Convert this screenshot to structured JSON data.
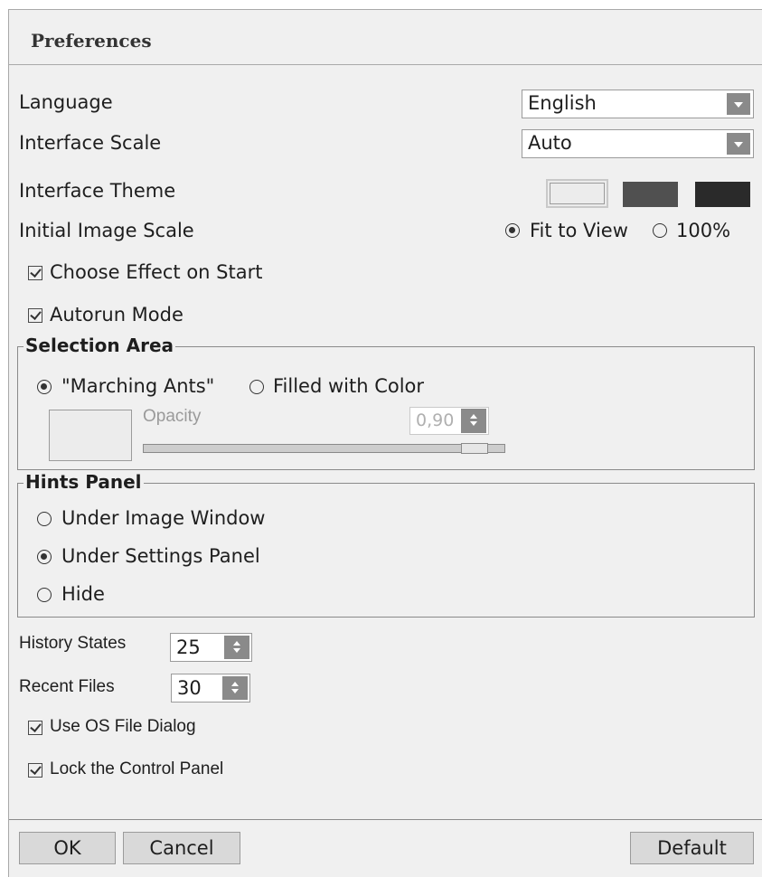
{
  "dialog": {
    "title": "Preferences",
    "language": {
      "label": "Language",
      "value": "English"
    },
    "interface_scale": {
      "label": "Interface Scale",
      "value": "Auto"
    },
    "interface_theme": {
      "label": "Interface Theme",
      "selected": "light",
      "colors": [
        "#ececec",
        "#505050",
        "#2a2a2a"
      ]
    },
    "initial_image_scale": {
      "label": "Initial Image Scale",
      "options": [
        "Fit to View",
        "100%"
      ],
      "selected": "Fit to View"
    },
    "choose_effect_on_start": {
      "label": "Choose Effect on Start",
      "checked": true
    },
    "autorun_mode": {
      "label": "Autorun Mode",
      "checked": true
    },
    "selection_area": {
      "title": "Selection Area",
      "options": [
        "\"Marching Ants\"",
        "Filled with Color"
      ],
      "selected": "\"Marching Ants\"",
      "opacity_label": "Opacity",
      "opacity_value": "0,90",
      "opacity_fraction": 0.9
    },
    "hints_panel": {
      "title": "Hints Panel",
      "options": [
        "Under Image Window",
        "Under Settings Panel",
        "Hide"
      ],
      "selected": "Under Settings Panel"
    },
    "history_states": {
      "label": "History States",
      "value": "25"
    },
    "recent_files": {
      "label": "Recent Files",
      "value": "30"
    },
    "use_os_file_dialog": {
      "label": "Use OS File Dialog",
      "checked": true
    },
    "lock_control_panel": {
      "label": "Lock the Control Panel",
      "checked": true
    },
    "buttons": {
      "ok": "OK",
      "cancel": "Cancel",
      "default": "Default"
    }
  },
  "colors": {
    "background": "#f0f0f0",
    "control_arrow": "#8a8a8a",
    "border": "#9b9b9b"
  }
}
